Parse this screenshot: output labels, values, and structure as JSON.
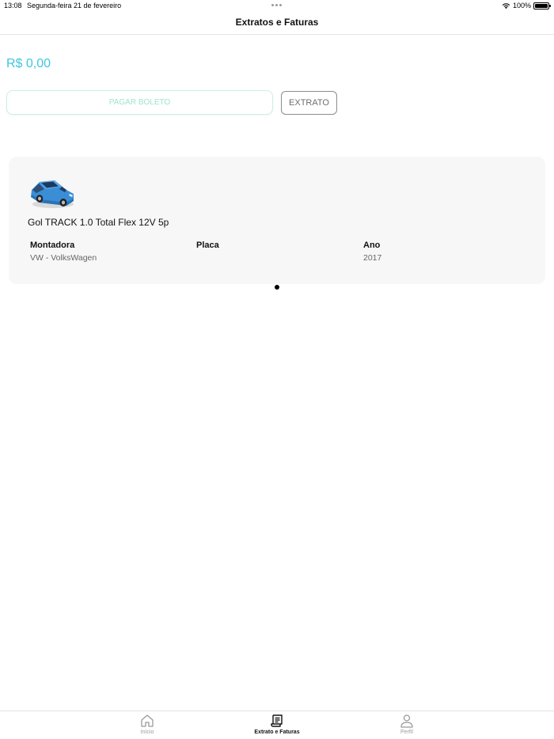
{
  "status_bar": {
    "time": "13:08",
    "date": "Segunda-feira 21 de fevereiro",
    "battery": "100%"
  },
  "header": {
    "title": "Extratos e Faturas"
  },
  "balance": "R$ 0,00",
  "actions": {
    "pay_label": "PAGAR BOLETO",
    "extract_label": "EXTRATO"
  },
  "vehicle": {
    "model": "Gol TRACK 1.0 Total Flex 12V 5p",
    "specs": {
      "make_label": "Montadora",
      "make_value": "VW - VolksWagen",
      "plate_label": "Placa",
      "plate_value": "",
      "year_label": "Ano",
      "year_value": "2017"
    }
  },
  "tabs": [
    {
      "label": "Início",
      "icon": "home-icon"
    },
    {
      "label": "Extrato e Faturas",
      "icon": "receipt-icon",
      "active": true
    },
    {
      "label": "Perfil",
      "icon": "person-icon"
    }
  ],
  "colors": {
    "accent": "#3ec6e0",
    "pay_button_text": "#9ee6c9",
    "car_body": "#3a8ed6"
  }
}
